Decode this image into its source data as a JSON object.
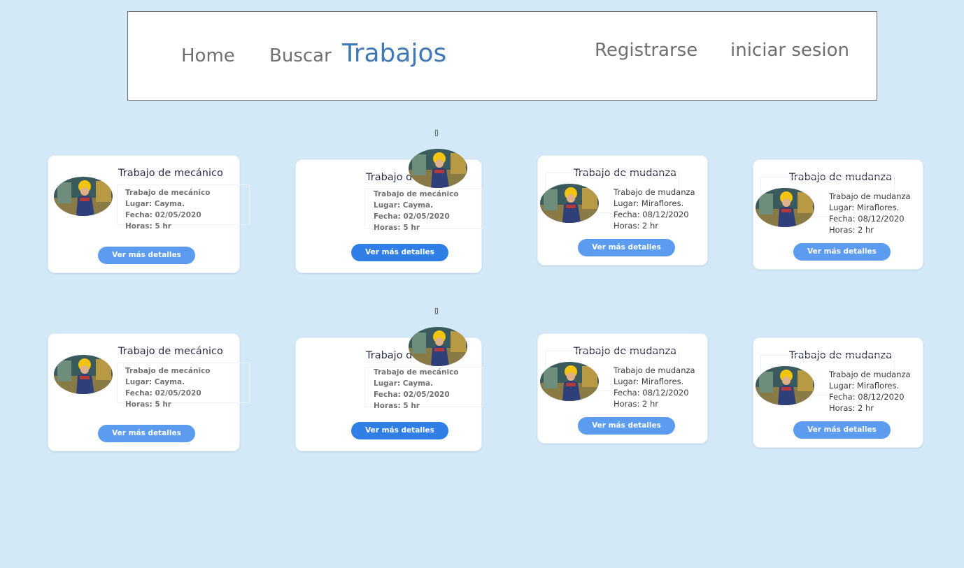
{
  "nav": {
    "home": "Home",
    "buscar": "Buscar",
    "trabajos": "Trabajos",
    "registrarse": "Registrarse",
    "iniciar_sesion": "iniciar sesion"
  },
  "colors": {
    "background": "#d3e9f7",
    "active_link": "#3f78b8",
    "button": "#5b9cf0",
    "button_dark": "#2f7fe6"
  },
  "glyph": "▯",
  "cards": [
    {
      "title": "Trabajo de mecánico",
      "lines": [
        "Trabajo de mecánico",
        "Lugar: Cayma.",
        "Fecha: 02/05/2020",
        "Horas: 5 hr"
      ],
      "button": "Ver más detalles"
    },
    {
      "title": "Trabajo d",
      "lines": [
        "Trabajo de mecánico",
        "Lugar: Cayma.",
        "Fecha: 02/05/2020",
        "Horas: 5 hr"
      ],
      "button": "Ver más detalles"
    },
    {
      "title": "Trabajo de mudanza",
      "lines": [
        "Trabajo de mudanza",
        "Lugar: Miraflores.",
        "Fecha: 08/12/2020",
        "Horas: 2 hr"
      ],
      "button": "Ver más detalles"
    },
    {
      "title": "Trabajo de mudanza",
      "lines": [
        "Trabajo de mudanza",
        "Lugar: Miraflores.",
        "Fecha: 08/12/2020",
        "Horas: 2 hr"
      ],
      "button": "Ver más detalles"
    }
  ]
}
